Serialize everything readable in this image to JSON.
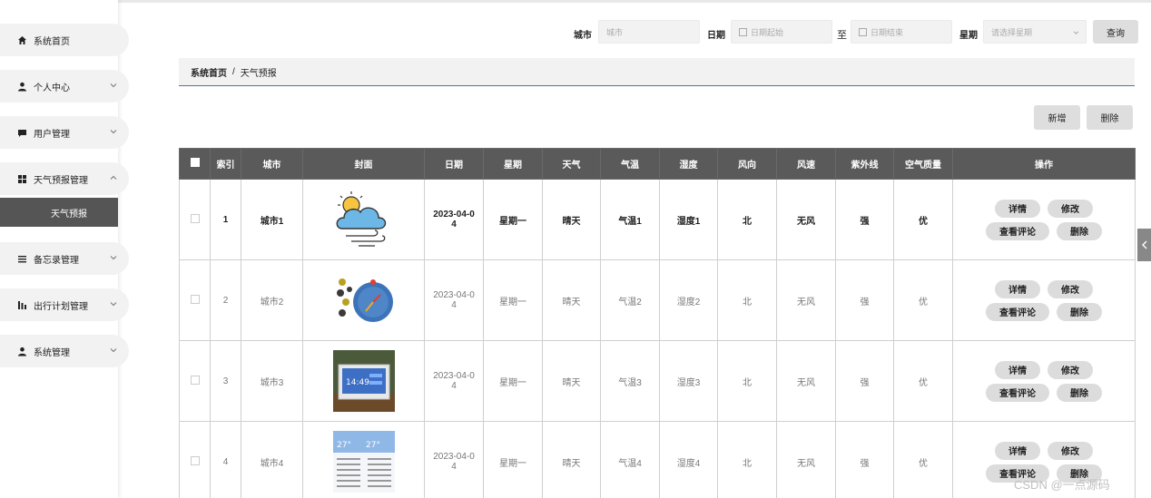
{
  "sidebar": {
    "items": [
      {
        "label": "系统首页",
        "icon": "home-icon"
      },
      {
        "label": "个人中心",
        "icon": "person-icon"
      },
      {
        "label": "用户管理",
        "icon": "chat-icon"
      },
      {
        "label": "天气预报管理",
        "icon": "grid-icon"
      },
      {
        "label": "备忘录管理",
        "icon": "list-icon"
      },
      {
        "label": "出行计划管理",
        "icon": "chart-icon"
      },
      {
        "label": "系统管理",
        "icon": "person-icon"
      }
    ],
    "sub_item": "天气预报"
  },
  "search": {
    "city_label": "城市",
    "city_placeholder": "城市",
    "date_label": "日期",
    "date_start_placeholder": "日期起始",
    "date_to": "至",
    "date_end_placeholder": "日期结束",
    "week_label": "星期",
    "week_placeholder": "请选择星期",
    "query_label": "查询"
  },
  "breadcrumb": {
    "home": "系统首页",
    "separator": "/",
    "current": "天气预报"
  },
  "actions": {
    "add_label": "新增",
    "delete_label": "删除"
  },
  "table": {
    "headers": [
      "索引",
      "城市",
      "封面",
      "日期",
      "星期",
      "天气",
      "气温",
      "湿度",
      "风向",
      "风速",
      "紫外线",
      "空气质量",
      "操作"
    ],
    "rows": [
      {
        "index": "1",
        "city": "城市1",
        "cover": "cloud-sun-wind-image",
        "date_a": "2023-04-0",
        "date_b": "4",
        "week": "星期一",
        "weather": "晴天",
        "temp": "气温1",
        "humidity": "湿度1",
        "wind_dir": "北",
        "wind_speed": "无风",
        "uv": "强",
        "air": "优"
      },
      {
        "index": "2",
        "city": "城市2",
        "cover": "weather-gauge-image",
        "date_a": "2023-04-0",
        "date_b": "4",
        "week": "星期一",
        "weather": "晴天",
        "temp": "气温2",
        "humidity": "湿度2",
        "wind_dir": "北",
        "wind_speed": "无风",
        "uv": "强",
        "air": "优"
      },
      {
        "index": "3",
        "city": "城市3",
        "cover": "weather-station-image",
        "date_a": "2023-04-0",
        "date_b": "4",
        "week": "星期一",
        "weather": "晴天",
        "temp": "气温3",
        "humidity": "湿度3",
        "wind_dir": "北",
        "wind_speed": "无风",
        "uv": "强",
        "air": "优"
      },
      {
        "index": "4",
        "city": "城市4",
        "cover": "weather-app-image",
        "date_a": "2023-04-0",
        "date_b": "4",
        "week": "星期一",
        "weather": "晴天",
        "temp": "气温4",
        "humidity": "湿度4",
        "wind_dir": "北",
        "wind_speed": "无风",
        "uv": "强",
        "air": "优"
      }
    ],
    "ops": {
      "detail": "详情",
      "edit": "修改",
      "comments": "查看评论",
      "delete": "删除"
    }
  },
  "station_time": "14:49",
  "app_temp": "27°",
  "watermark": "CSDN @一点源码",
  "colors": {
    "header_bg": "#5a5a5a",
    "button_bg": "#dedede",
    "breadcrumb_line": "#5a6ea8"
  }
}
